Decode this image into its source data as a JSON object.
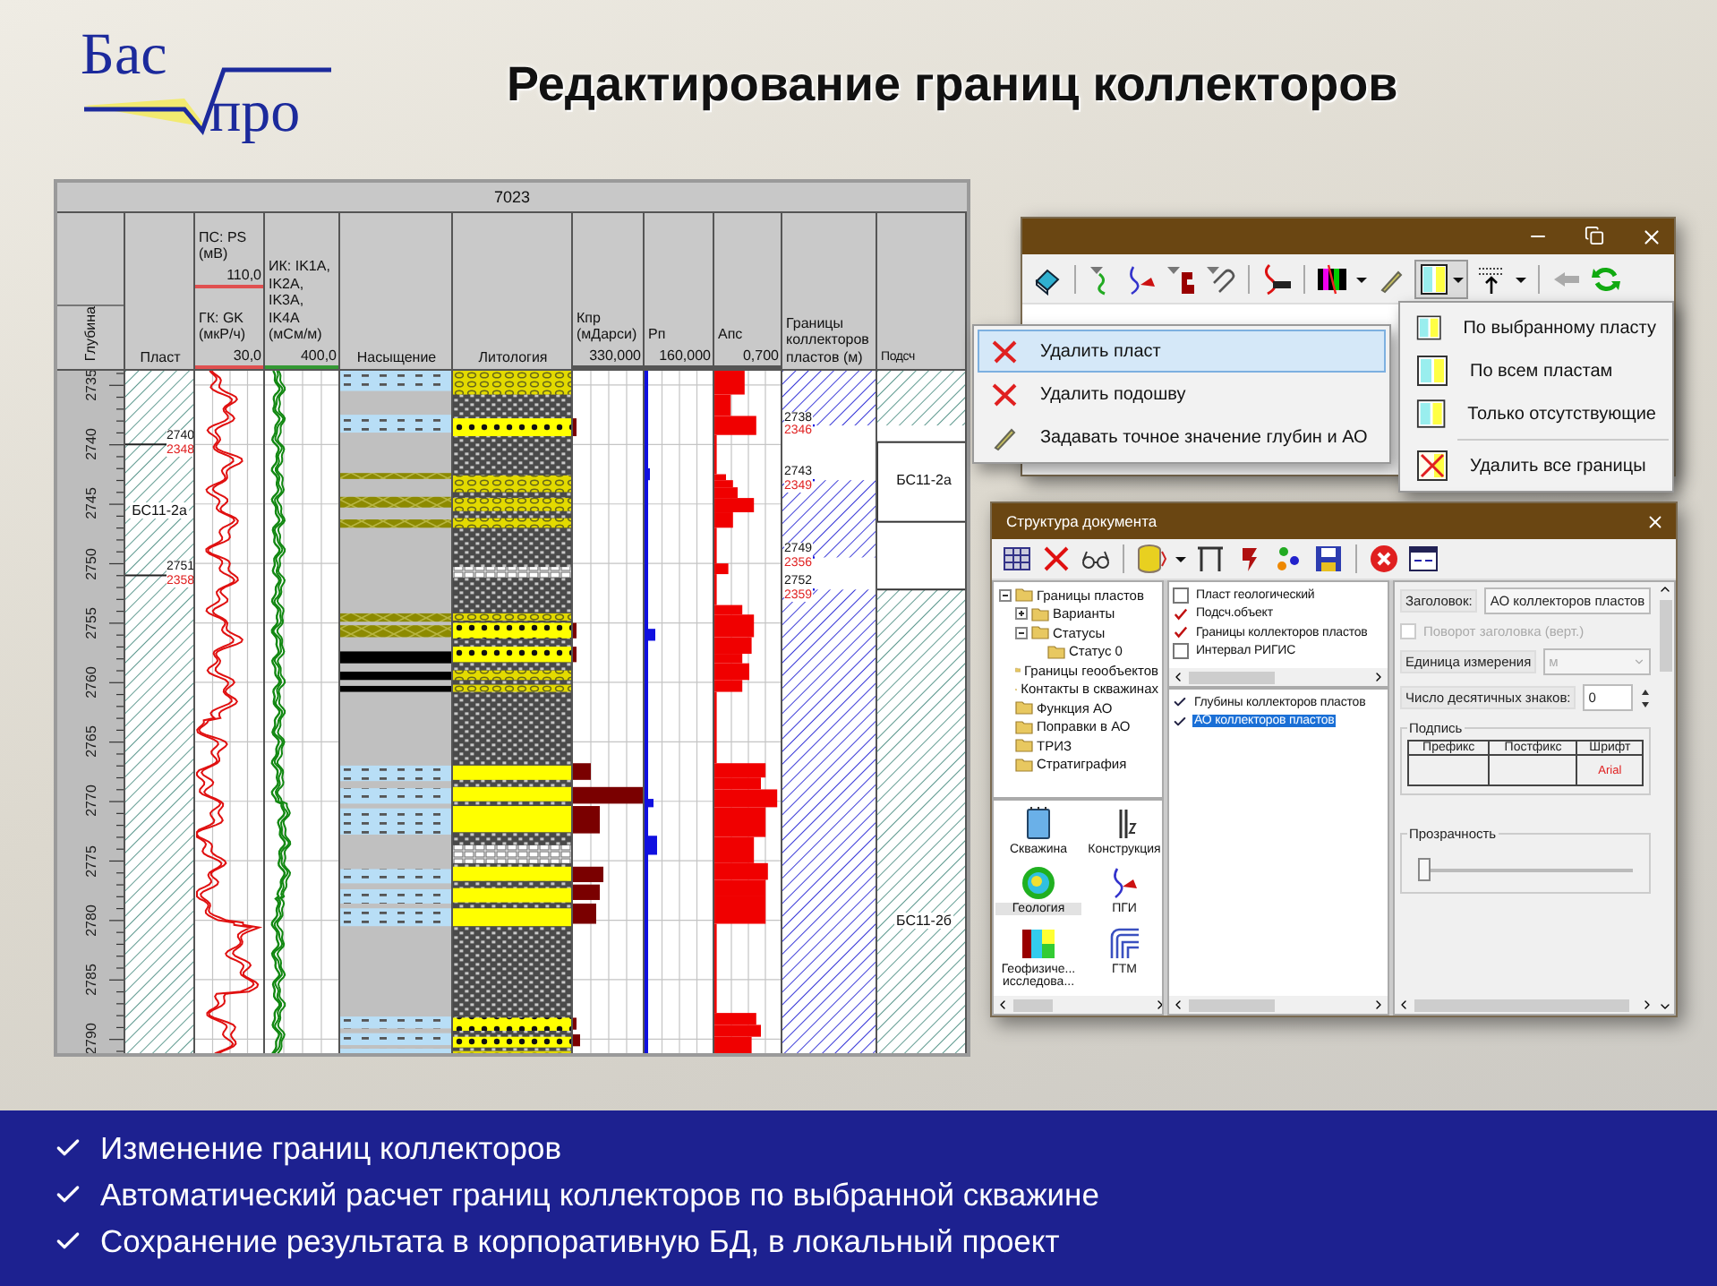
{
  "logo": {
    "top": "Бас",
    "bottom": "про"
  },
  "title": "Редактирование границ коллекторов",
  "log": {
    "well": "7023",
    "headers": {
      "depth": "Глубина",
      "plast": "Пласт",
      "ps": {
        "title": "ПС: PS (мВ)",
        "scale": "110,0"
      },
      "gk": {
        "title": "ГК: GK (мкР/ч)",
        "scale": "30,0"
      },
      "ik": {
        "title": "ИК: IK1A, IK2A, IK3A, IK4A (мСм/м)",
        "scale": "400,0"
      },
      "saturation": "Насыщение",
      "lithology": "Литология",
      "kpr": {
        "title": "Кпр (мДарси)",
        "scale": "330,000"
      },
      "rp": {
        "title": "Рп",
        "scale": "160,000"
      },
      "aps": {
        "title": "Апс",
        "scale": "0,700"
      },
      "boundaries": "Границы коллекторов пластов (м)",
      "podsch": "Подсч"
    },
    "depths": [
      "2735",
      "2740",
      "2745",
      "2750",
      "2755",
      "2760",
      "2765",
      "2770",
      "2775",
      "2780",
      "2785",
      "2790"
    ],
    "plast_marks": [
      {
        "depth": "2740",
        "abs": "2348"
      },
      {
        "depth": "2751",
        "abs": "2358"
      }
    ],
    "plast_name": "БС11-2а",
    "boundary_marks": [
      {
        "depth": "2738",
        "abs": "2346"
      },
      {
        "depth": "2743",
        "abs": "2349"
      },
      {
        "depth": "2749",
        "abs": "2356"
      },
      {
        "depth": "2752",
        "abs": "2359"
      }
    ],
    "podsch_names": [
      "БС11-2а",
      "БС11-2б"
    ]
  },
  "context_menu": [
    {
      "label": "Удалить пласт",
      "kind": "delete",
      "selected": true
    },
    {
      "label": "Удалить подошву",
      "kind": "delete",
      "selected": false
    },
    {
      "label": "Задавать точное значение глубин и АО",
      "kind": "edit",
      "selected": false
    }
  ],
  "dropdown_menu": [
    {
      "label": "По выбранному пласту",
      "kind": "fill"
    },
    {
      "label": "По всем пластам",
      "kind": "fill"
    },
    {
      "label": "Только отсутствующие",
      "kind": "fill"
    },
    {
      "label": "Удалить все границы",
      "kind": "clear"
    }
  ],
  "structure_window": {
    "title": "Структура документа",
    "tree": [
      {
        "label": "Границы пластов",
        "expanded": true,
        "children": [
          {
            "label": "Варианты",
            "expanded": false
          },
          {
            "label": "Статусы",
            "expanded": true,
            "children": [
              {
                "label": "Статус 0"
              }
            ]
          }
        ]
      },
      {
        "label": "Границы геообъектов"
      },
      {
        "label": "Контакты в скважинах"
      },
      {
        "label": "Функция АО"
      },
      {
        "label": "Поправки в АО"
      },
      {
        "label": "ТРИЗ"
      },
      {
        "label": "Стратиграфия"
      }
    ],
    "layers": [
      {
        "label": "Пласт геологический",
        "checked": false
      },
      {
        "label": "Подсч.объект",
        "checked": true
      },
      {
        "label": "Границы  коллекторов пластов",
        "checked": true
      },
      {
        "label": "Интервал РИГИС",
        "checked": false
      }
    ],
    "fields": [
      {
        "label": "Глубины  коллекторов пластов",
        "selected": false
      },
      {
        "label": "АО  коллекторов пластов",
        "selected": true
      }
    ],
    "modules": [
      {
        "label": "Скважина",
        "kind": "well",
        "selected": false
      },
      {
        "label": "Конструкция",
        "kind": "construction",
        "selected": false
      },
      {
        "label": "Геология",
        "kind": "geology",
        "selected": true
      },
      {
        "label": "ПГИ",
        "kind": "pgi",
        "selected": false
      },
      {
        "label": "Геофизиче... исследова...",
        "kind": "geophysics",
        "selected": false
      },
      {
        "label": "ГТМ",
        "kind": "gtm",
        "selected": false
      }
    ],
    "properties": {
      "caption_label": "Заголовок:",
      "caption_value": "АО  коллекторов пластов",
      "rotate": {
        "label": "Поворот заголовка (верт.)",
        "checked": false,
        "disabled": true
      },
      "unit": {
        "label": "Единица измерения",
        "value": "м",
        "disabled": true
      },
      "decimals": {
        "label": "Число десятичных знаков:",
        "value": "0"
      },
      "signature": {
        "title": "Подпись",
        "columns": [
          "Префикс",
          "Постфикс",
          "Шрифт"
        ],
        "font": "Arial"
      },
      "transparency": {
        "title": "Прозрачность",
        "level": 0
      }
    }
  },
  "bullets": [
    "Изменение границ коллекторов",
    "Автоматический расчет границ коллекторов по выбранной скважине",
    "Сохранение результата в корпоративную БД, в локальный проект"
  ]
}
